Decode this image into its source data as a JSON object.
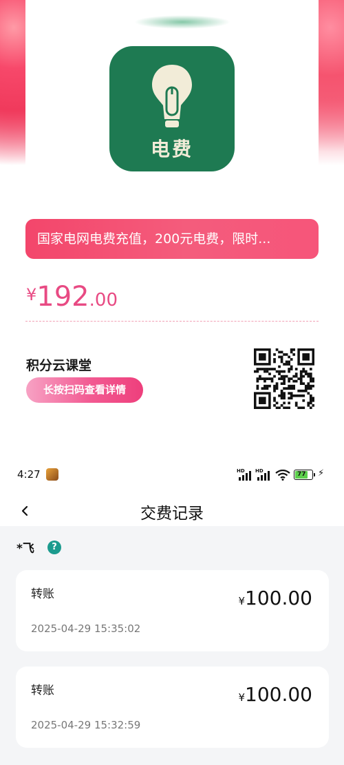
{
  "poster": {
    "icon_text": "电费",
    "title": "国家电网电费充值，200元电费，限时...",
    "price": {
      "currency": "¥",
      "integer": "192",
      "decimal": ".00"
    },
    "brand": "积分云课堂",
    "detail_button": "长按扫码查看详情",
    "colors": {
      "icon_bg": "#1e7a52",
      "accent_pink": "#f3466b",
      "price_pink": "#e84a83"
    }
  },
  "status_bar": {
    "time": "4:27",
    "signal_1": "HD",
    "signal_2": "HD",
    "battery_level": "77",
    "icons": [
      "game-app-icon",
      "signal-icon",
      "signal-icon",
      "wifi-icon",
      "battery-icon",
      "charging-bolt-icon"
    ]
  },
  "header": {
    "title": "交费记录",
    "back_icon": "chevron-left-icon"
  },
  "payer": {
    "name": "*飞",
    "help_icon": "?"
  },
  "records": [
    {
      "type": "转账",
      "currency": "¥",
      "amount": "100.00",
      "time": "2025-04-29 15:35:02"
    },
    {
      "type": "转账",
      "currency": "¥",
      "amount": "100.00",
      "time": "2025-04-29 15:32:59"
    }
  ]
}
